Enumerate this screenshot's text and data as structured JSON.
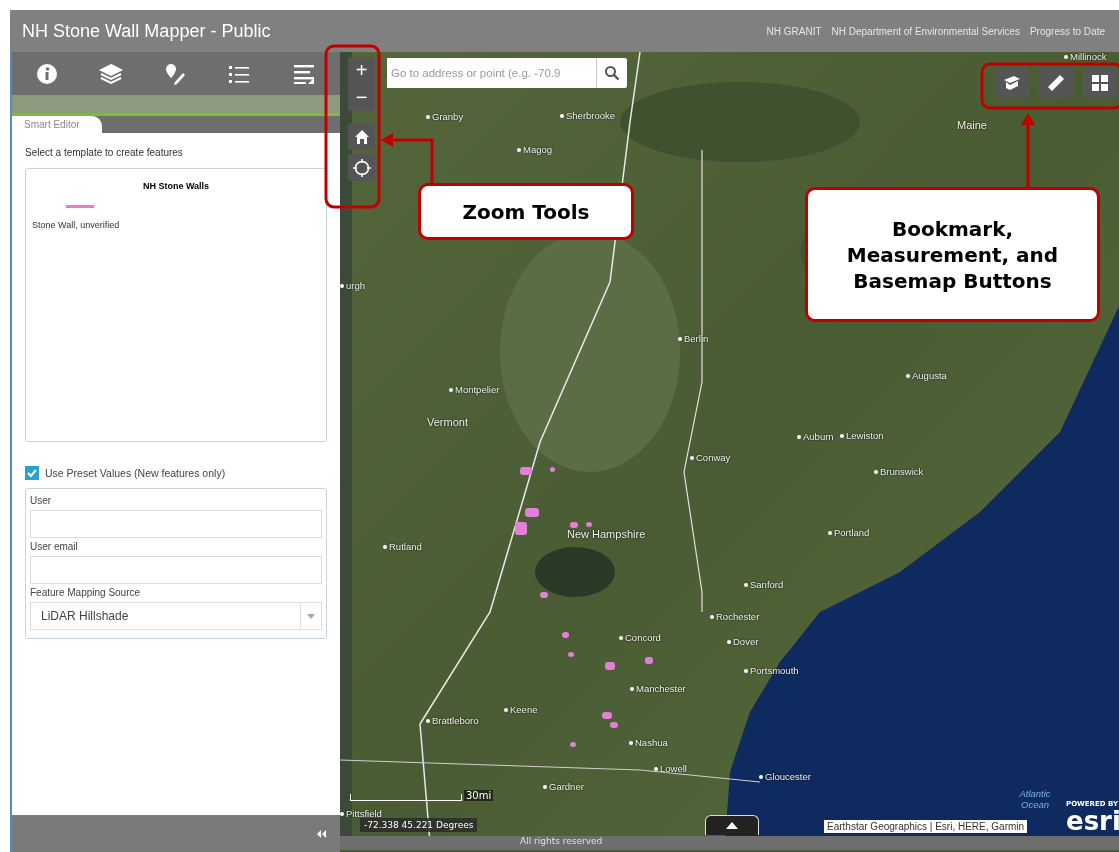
{
  "header": {
    "title": "NH Stone Wall Mapper - Public",
    "links": [
      "NH GRANIT",
      "NH Department of Environmental Services",
      "Progress to Date"
    ]
  },
  "toolbar": [
    {
      "kind": "info"
    },
    {
      "kind": "layers"
    },
    {
      "kind": "edit"
    },
    {
      "kind": "list"
    },
    {
      "kind": "legend"
    }
  ],
  "panel": {
    "tab": "Smart Editor",
    "instruction": "Select a template to create features",
    "template_group": "NH Stone Walls",
    "template": {
      "label": "Stone Wall, unverified",
      "color": "#ee77d4"
    },
    "preset": {
      "label": "Use Preset Values (New features only)",
      "checked": true
    },
    "fields": [
      {
        "kind": "text",
        "label": "User"
      },
      {
        "kind": "text",
        "label": "User email"
      },
      {
        "kind": "select",
        "label": "Feature Mapping Source",
        "value": "LiDAR Hillshade"
      }
    ]
  },
  "map": {
    "search_placeholder": "Go to address or point (e.g. -70.9",
    "zoom_in": "+",
    "zoom_out": "−",
    "labels": [
      {
        "kind": "city",
        "text": "Millinock"
      },
      {
        "kind": "city",
        "text": "Granby"
      },
      {
        "kind": "city",
        "text": "Sherbrooke"
      },
      {
        "kind": "city",
        "text": "Magog"
      },
      {
        "kind": "region",
        "text": "Maine"
      },
      {
        "kind": "city",
        "text": "urgh"
      },
      {
        "kind": "city",
        "text": "Berlin"
      },
      {
        "kind": "city",
        "text": "Montpelier"
      },
      {
        "kind": "region",
        "text": "Vermont"
      },
      {
        "kind": "city",
        "text": "Augusta"
      },
      {
        "kind": "city",
        "text": "Auburn"
      },
      {
        "kind": "city",
        "text": "Lewiston"
      },
      {
        "kind": "city",
        "text": "Conway"
      },
      {
        "kind": "city",
        "text": "Brunswick"
      },
      {
        "kind": "region",
        "text": "New Hampshire"
      },
      {
        "kind": "city",
        "text": "Portland"
      },
      {
        "kind": "city",
        "text": "Rutland"
      },
      {
        "kind": "city",
        "text": "Sanford"
      },
      {
        "kind": "city",
        "text": "Rochester"
      },
      {
        "kind": "city",
        "text": "Concord"
      },
      {
        "kind": "city",
        "text": "Dover"
      },
      {
        "kind": "city",
        "text": "Portsmouth"
      },
      {
        "kind": "city",
        "text": "Manchester"
      },
      {
        "kind": "city",
        "text": "Keene"
      },
      {
        "kind": "city",
        "text": "Brattleboro"
      },
      {
        "kind": "city",
        "text": "Nashua"
      },
      {
        "kind": "city",
        "text": "Lowell"
      },
      {
        "kind": "city",
        "text": "Gloucester"
      },
      {
        "kind": "city",
        "text": "Gardner"
      },
      {
        "kind": "city",
        "text": "Pittsfield"
      },
      {
        "kind": "water",
        "text": "Atlantic Ocean"
      }
    ],
    "scale": "30mi",
    "coordinates": "-72.338 45.221 Degrees",
    "attribution": "Earthstar Geographics | Esri, HERE, Garmin",
    "powered_by": "POWERED BY",
    "logo": "esri",
    "rights": "All rights reserved"
  },
  "callouts": [
    {
      "text": "Zoom Tools"
    },
    {
      "text": "Bookmark, Measurement, and Basemap Buttons"
    }
  ]
}
